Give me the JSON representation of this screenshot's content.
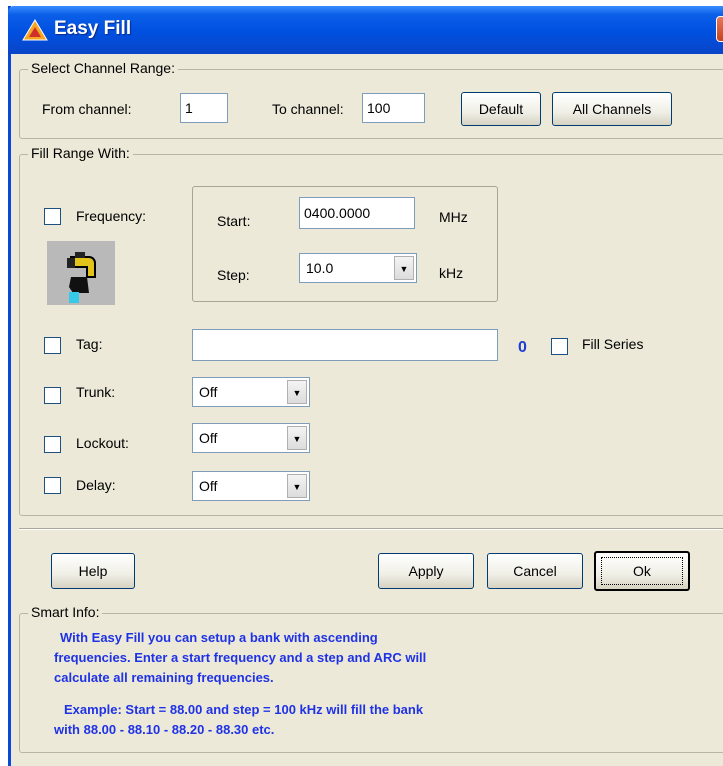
{
  "window": {
    "title": "Easy Fill",
    "close_glyph": "X",
    "icon": "app-triangle-icon",
    "colors": {
      "titlebar": "#0050e0",
      "face": "#ece9d8",
      "info_text": "#1f32e6"
    }
  },
  "channel_range": {
    "group_label": "Select Channel Range:",
    "from_label": "From channel:",
    "from_value": "1",
    "to_label": "To channel:",
    "to_value": "100",
    "default_button": "Default",
    "all_channels_button": "All Channels"
  },
  "fill": {
    "group_label": "Fill Range With:",
    "frequency": {
      "label": "Frequency:",
      "checked": false,
      "start_label": "Start:",
      "start_value": "0400.0000",
      "start_unit": "MHz",
      "step_label": "Step:",
      "step_value": "10.0",
      "step_unit": "kHz",
      "icon": "faucet-icon"
    },
    "tag": {
      "label": "Tag:",
      "value": "",
      "count": "0",
      "fill_series_label": "Fill Series"
    },
    "trunk": {
      "label": "Trunk:",
      "value": "Off"
    },
    "lockout": {
      "label": "Lockout:",
      "value": "Off"
    },
    "delay": {
      "label": "Delay:",
      "value": "Off"
    }
  },
  "buttons": {
    "help": "Help",
    "apply": "Apply",
    "cancel": "Cancel",
    "ok": "Ok"
  },
  "smart_info": {
    "group_label": "Smart Info:",
    "line1": "With Easy Fill you can setup a bank with ascending",
    "line2": "frequencies. Enter a start frequency and a step and ARC will",
    "line3": "calculate all remaining frequencies.",
    "line4": "Example: Start = 88.00 and step = 100 kHz will fill the bank",
    "line5": "with 88.00 - 88.10 - 88.20 - 88.30 etc."
  }
}
